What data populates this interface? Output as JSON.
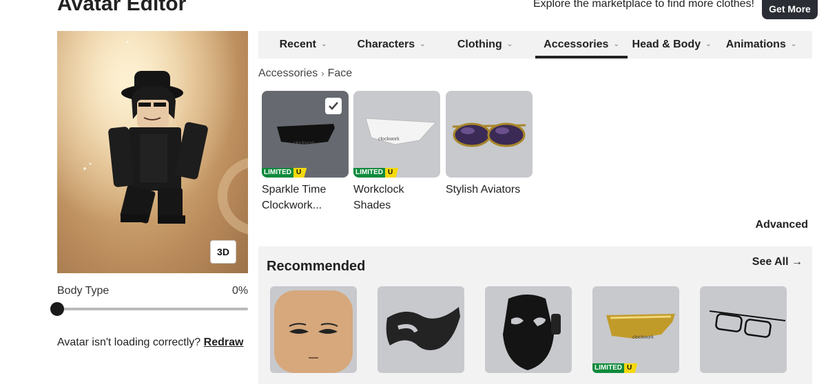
{
  "header": {
    "title": "Avatar Editor",
    "promo_text": "Explore the marketplace to find more clothes!",
    "get_more_label": "Get More"
  },
  "preview": {
    "view_toggle_label": "3D",
    "body_type_label": "Body Type",
    "body_type_value": "0%",
    "body_type_level": 0,
    "redraw_prompt": "Avatar isn't loading correctly?",
    "redraw_link": "Redraw"
  },
  "tabs": [
    {
      "label": "Recent",
      "active": false
    },
    {
      "label": "Characters",
      "active": false
    },
    {
      "label": "Clothing",
      "active": false
    },
    {
      "label": "Accessories",
      "active": true
    },
    {
      "label": "Head & Body",
      "active": false
    },
    {
      "label": "Animations",
      "active": false
    }
  ],
  "breadcrumb": {
    "parent": "Accessories",
    "current": "Face"
  },
  "items": [
    {
      "name_line1": "Sparkle Time",
      "name_line2": "Clockwork...",
      "limited_label": "LIMITED",
      "unique_label": "U",
      "selected": true,
      "icon": "dark-sunglasses-icon"
    },
    {
      "name_line1": "Workclock",
      "name_line2": "Shades",
      "limited_label": "LIMITED",
      "unique_label": "U",
      "selected": false,
      "icon": "white-shades-icon"
    },
    {
      "name_line1": "Stylish Aviators",
      "name_line2": "",
      "selected": false,
      "icon": "aviator-glasses-icon"
    }
  ],
  "advanced_label": "Advanced",
  "recommended": {
    "title": "Recommended",
    "see_all_label": "See All",
    "limited_label": "LIMITED",
    "unique_label": "U",
    "items": [
      {
        "icon": "face-head-icon"
      },
      {
        "icon": "scribble-mask-icon"
      },
      {
        "icon": "black-mask-icon"
      },
      {
        "icon": "gold-visor-icon",
        "limited": true
      },
      {
        "icon": "wire-glasses-icon"
      }
    ]
  },
  "colors": {
    "accent": "#222222",
    "limited_green": "#0e8a3c",
    "unique_yellow": "#f5d90a",
    "card_bg": "#c8c9cd",
    "panel_bg": "#f2f2f2"
  }
}
